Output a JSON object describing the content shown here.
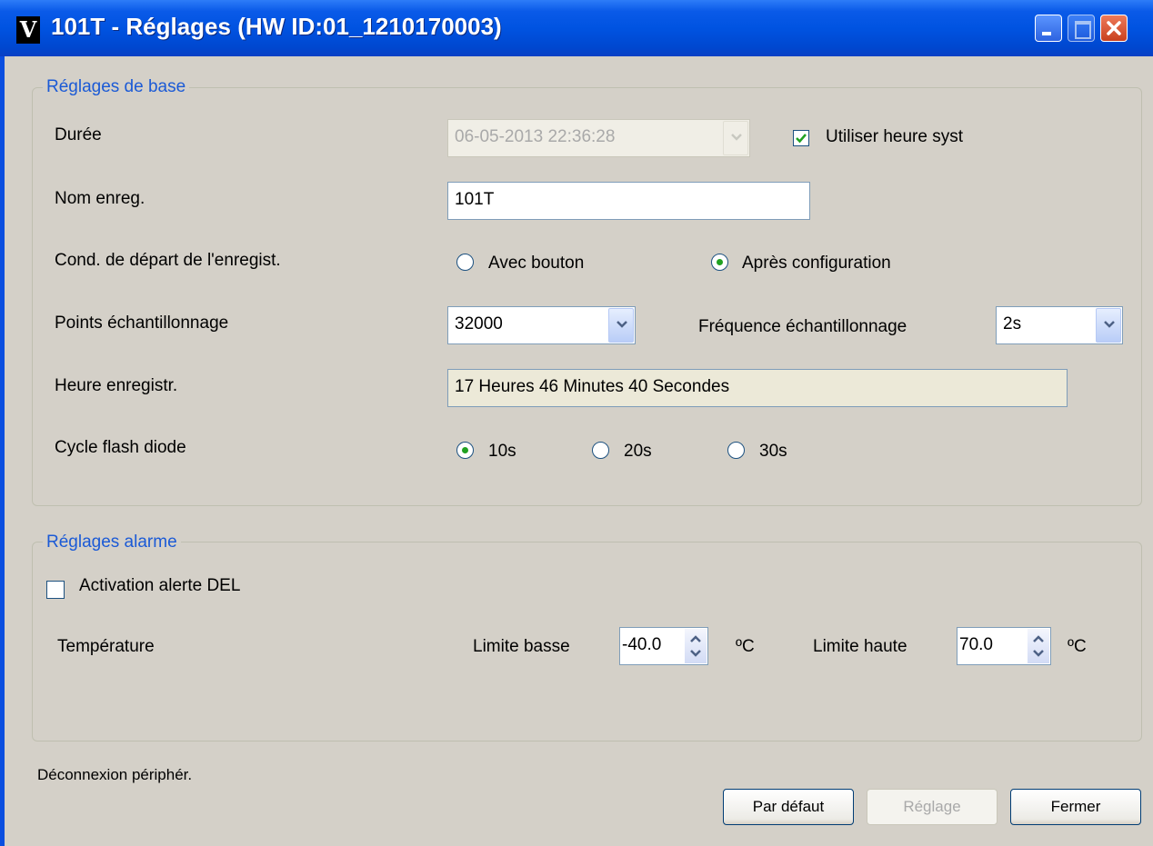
{
  "window": {
    "title": "101T - Réglages (HW ID:01_1210170003)",
    "app_icon": "V",
    "accent": "#0a4ee0"
  },
  "basic": {
    "legend": "Réglages de base",
    "duration_label": "Durée",
    "duration_value": "06-05-2013 22:36:28",
    "use_system_time_label": "Utiliser heure syst",
    "use_system_time_checked": true,
    "name_label": "Nom enreg.",
    "name_value": "101T",
    "start_condition_label": "Cond. de départ de l'enregist.",
    "start_option_button": "Avec bouton",
    "start_option_config": "Après configuration",
    "start_selected": "Après configuration",
    "points_label": "Points échantillonnage",
    "points_value": "32000",
    "frequency_label": "Fréquence échantillonnage",
    "frequency_value": "2s",
    "record_time_label": "Heure enregistr.",
    "record_time_value": "17 Heures 46 Minutes 40 Secondes",
    "flash_cycle_label": "Cycle flash diode",
    "flash_options": [
      "10s",
      "20s",
      "30s"
    ],
    "flash_selected": "10s"
  },
  "alarm": {
    "legend": "Réglages alarme",
    "led_alert_label": "Activation alerte DEL",
    "led_alert_checked": false,
    "temperature_label": "Température",
    "low_limit_label": "Limite basse",
    "low_limit_value": "-40.0",
    "high_limit_label": "Limite haute",
    "high_limit_value": "70.0",
    "unit": "ºC"
  },
  "status": {
    "text": "Déconnexion périphér."
  },
  "buttons": {
    "default": "Par défaut",
    "apply": "Réglage",
    "close": "Fermer"
  }
}
